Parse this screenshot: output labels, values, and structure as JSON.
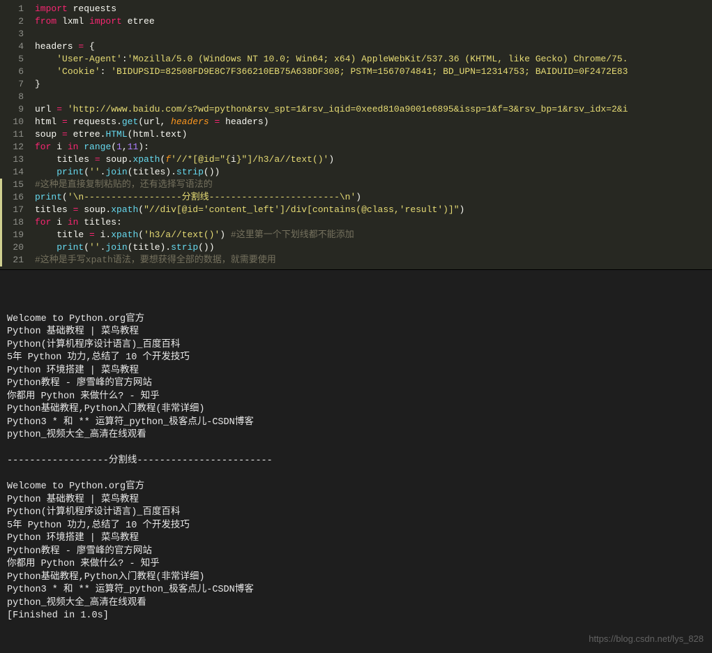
{
  "editor": {
    "lines": [
      {
        "n": 1,
        "tokens": [
          [
            "kw",
            "import"
          ],
          [
            "white",
            " requests"
          ]
        ]
      },
      {
        "n": 2,
        "tokens": [
          [
            "kw",
            "from"
          ],
          [
            "white",
            " lxml "
          ],
          [
            "kw",
            "import"
          ],
          [
            "white",
            " etree"
          ]
        ]
      },
      {
        "n": 3,
        "tokens": []
      },
      {
        "n": 4,
        "tokens": [
          [
            "white",
            "headers "
          ],
          [
            "op",
            "="
          ],
          [
            "white",
            " {"
          ]
        ]
      },
      {
        "n": 5,
        "tokens": [
          [
            "white",
            "    "
          ],
          [
            "str",
            "'User-Agent'"
          ],
          [
            "white",
            ":"
          ],
          [
            "str",
            "'Mozilla/5.0 (Windows NT 10.0; Win64; x64) AppleWebKit/537.36 (KHTML, like Gecko) Chrome/75."
          ]
        ]
      },
      {
        "n": 6,
        "tokens": [
          [
            "white",
            "    "
          ],
          [
            "str",
            "'Cookie'"
          ],
          [
            "white",
            ": "
          ],
          [
            "str",
            "'BIDUPSID=82508FD9E8C7F366210EB75A638DF308; PSTM=1567074841; BD_UPN=12314753; BAIDUID=0F2472E83"
          ]
        ]
      },
      {
        "n": 7,
        "tokens": [
          [
            "white",
            "}"
          ]
        ]
      },
      {
        "n": 8,
        "tokens": []
      },
      {
        "n": 9,
        "tokens": [
          [
            "white",
            "url "
          ],
          [
            "op",
            "="
          ],
          [
            "white",
            " "
          ],
          [
            "str",
            "'http://www.baidu.com/s?wd=python&rsv_spt=1&rsv_iqid=0xeed810a9001e6895&issp=1&f=3&rsv_bp=1&rsv_idx=2&i"
          ]
        ]
      },
      {
        "n": 10,
        "tokens": [
          [
            "white",
            "html "
          ],
          [
            "op",
            "="
          ],
          [
            "white",
            " requests."
          ],
          [
            "fn",
            "get"
          ],
          [
            "white",
            "(url, "
          ],
          [
            "param",
            "headers"
          ],
          [
            "white",
            " "
          ],
          [
            "op",
            "="
          ],
          [
            "white",
            " headers)"
          ]
        ]
      },
      {
        "n": 11,
        "tokens": [
          [
            "white",
            "soup "
          ],
          [
            "op",
            "="
          ],
          [
            "white",
            " etree."
          ],
          [
            "fn",
            "HTML"
          ],
          [
            "white",
            "(html.text)"
          ]
        ]
      },
      {
        "n": 12,
        "tokens": [
          [
            "kw",
            "for"
          ],
          [
            "white",
            " i "
          ],
          [
            "kw",
            "in"
          ],
          [
            "white",
            " "
          ],
          [
            "fn",
            "range"
          ],
          [
            "white",
            "("
          ],
          [
            "num",
            "1"
          ],
          [
            "white",
            ","
          ],
          [
            "num",
            "11"
          ],
          [
            "white",
            "):"
          ]
        ]
      },
      {
        "n": 13,
        "tokens": [
          [
            "white",
            "    titles "
          ],
          [
            "op",
            "="
          ],
          [
            "white",
            " soup."
          ],
          [
            "fn",
            "xpath"
          ],
          [
            "white",
            "("
          ],
          [
            "param",
            "f"
          ],
          [
            "str",
            "'//*[@id=\"{"
          ],
          [
            "white",
            "i"
          ],
          [
            "str",
            "}\"]/h3/a//text()'"
          ],
          [
            "white",
            ")"
          ]
        ]
      },
      {
        "n": 14,
        "tokens": [
          [
            "white",
            "    "
          ],
          [
            "fn",
            "print"
          ],
          [
            "white",
            "("
          ],
          [
            "str",
            "''"
          ],
          [
            "white",
            "."
          ],
          [
            "fn",
            "join"
          ],
          [
            "white",
            "(titles)."
          ],
          [
            "fn",
            "strip"
          ],
          [
            "white",
            "())"
          ]
        ]
      },
      {
        "n": 15,
        "tokens": [
          [
            "comment",
            "#这种是直接复制粘贴的，还有选择写语法的"
          ]
        ]
      },
      {
        "n": 16,
        "tokens": [
          [
            "fn",
            "print"
          ],
          [
            "white",
            "("
          ],
          [
            "str",
            "'\\n------------------分割线------------------------\\n'"
          ],
          [
            "white",
            ")"
          ]
        ]
      },
      {
        "n": 17,
        "tokens": [
          [
            "white",
            "titles "
          ],
          [
            "op",
            "="
          ],
          [
            "white",
            " soup."
          ],
          [
            "fn",
            "xpath"
          ],
          [
            "white",
            "("
          ],
          [
            "str",
            "\"//div[@id='content_left']/div[contains(@class,'result')]\""
          ],
          [
            "white",
            ")"
          ]
        ]
      },
      {
        "n": 18,
        "tokens": [
          [
            "kw",
            "for"
          ],
          [
            "white",
            " i "
          ],
          [
            "kw",
            "in"
          ],
          [
            "white",
            " titles:"
          ]
        ]
      },
      {
        "n": 19,
        "tokens": [
          [
            "white",
            "    title "
          ],
          [
            "op",
            "="
          ],
          [
            "white",
            " i."
          ],
          [
            "fn",
            "xpath"
          ],
          [
            "white",
            "("
          ],
          [
            "str",
            "'h3/a//text()'"
          ],
          [
            "white",
            ") "
          ],
          [
            "comment",
            "#这里第一个下划线都不能添加"
          ]
        ]
      },
      {
        "n": 20,
        "tokens": [
          [
            "white",
            "    "
          ],
          [
            "fn",
            "print"
          ],
          [
            "white",
            "("
          ],
          [
            "str",
            "''"
          ],
          [
            "white",
            "."
          ],
          [
            "fn",
            "join"
          ],
          [
            "white",
            "(title)."
          ],
          [
            "fn",
            "strip"
          ],
          [
            "white",
            "())"
          ]
        ]
      },
      {
        "n": 21,
        "tokens": [
          [
            "comment",
            "#这种是手写xpath语法，要想获得全部的数据，就需要使用"
          ]
        ]
      }
    ],
    "edit_markers": [
      15,
      16,
      17,
      18,
      19,
      20,
      21
    ]
  },
  "terminal": {
    "lines": [
      "",
      "Welcome to Python.org官方",
      "Python 基础教程 | 菜鸟教程",
      "Python(计算机程序设计语言)_百度百科",
      "5年 Python 功力,总结了 10 个开发技巧",
      "Python 环境搭建 | 菜鸟教程",
      "Python教程 - 廖雪峰的官方网站",
      "你都用 Python 来做什么? - 知乎",
      "Python基础教程,Python入门教程(非常详细)",
      "Python3 * 和 ** 运算符_python_极客点儿-CSDN博客",
      "python_视频大全_高清在线观看",
      "",
      "------------------分割线------------------------",
      "",
      "Welcome to Python.org官方",
      "Python 基础教程 | 菜鸟教程",
      "Python(计算机程序设计语言)_百度百科",
      "5年 Python 功力,总结了 10 个开发技巧",
      "Python 环境搭建 | 菜鸟教程",
      "Python教程 - 廖雪峰的官方网站",
      "你都用 Python 来做什么? - 知乎",
      "Python基础教程,Python入门教程(非常详细)",
      "Python3 * 和 ** 运算符_python_极客点儿-CSDN博客",
      "python_视频大全_高清在线观看",
      "[Finished in 1.0s]"
    ]
  },
  "watermark": "https://blog.csdn.net/lys_828"
}
